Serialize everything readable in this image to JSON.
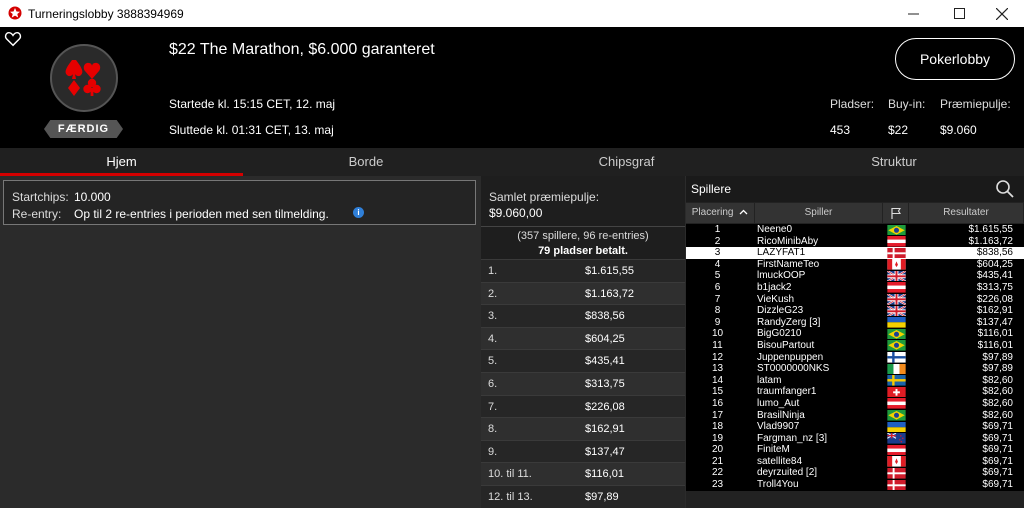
{
  "window": {
    "title": "Turneringslobby 3888394969"
  },
  "tournament": {
    "name": "$22 The Marathon, $6.000 garanteret",
    "status": "FÆRDIG",
    "started": "Startede kl. 15:15 CET, 12. maj",
    "ended": "Sluttede kl. 01:31 CET, 13. maj",
    "lobby_button": "Pokerlobby",
    "seats_label": "Pladser:",
    "seats_value": "453",
    "buyin_label": "Buy-in:",
    "buyin_value": "$22",
    "prizepool_label": "Præmiepulje:",
    "prizepool_value": "$9.060"
  },
  "tabs": [
    {
      "label": "Hjem",
      "active": true
    },
    {
      "label": "Borde",
      "active": false
    },
    {
      "label": "Chipsgraf",
      "active": false
    },
    {
      "label": "Struktur",
      "active": false
    }
  ],
  "info": {
    "startchips_label": "Startchips:",
    "startchips_value": "10.000",
    "reentry_label": "Re-entry:",
    "reentry_value": "Op til 2 re-entries i perioden med sen tilmelding."
  },
  "prizepool": {
    "label": "Samlet præmiepulje:",
    "value": "$9.060,00",
    "players_text": "(357 spillere, 96 re-entries)",
    "paid_text": "79 pladser betalt.",
    "payouts": [
      {
        "place": "1.",
        "amount": "$1.615,55"
      },
      {
        "place": "2.",
        "amount": "$1.163,72"
      },
      {
        "place": "3.",
        "amount": "$838,56"
      },
      {
        "place": "4.",
        "amount": "$604,25"
      },
      {
        "place": "5.",
        "amount": "$435,41"
      },
      {
        "place": "6.",
        "amount": "$313,75"
      },
      {
        "place": "7.",
        "amount": "$226,08"
      },
      {
        "place": "8.",
        "amount": "$162,91"
      },
      {
        "place": "9.",
        "amount": "$137,47"
      },
      {
        "place": "10. til 11.",
        "amount": "$116,01"
      },
      {
        "place": "12. til 13.",
        "amount": "$97,89"
      }
    ]
  },
  "players": {
    "title": "Spillere",
    "columns": {
      "place": "Placering",
      "player": "Spiller",
      "results": "Resultater"
    },
    "highlight_color": "#ffffff",
    "rows": [
      {
        "place": "1",
        "name": "Neene0",
        "flag": "br",
        "result": "$1.615,55"
      },
      {
        "place": "2",
        "name": "RicoMinibAby",
        "flag": "at",
        "result": "$1.163,72"
      },
      {
        "place": "3",
        "name": "LAZYFAT1",
        "flag": "dk",
        "result": "$838,56",
        "highlight": true
      },
      {
        "place": "4",
        "name": "FirstNameTeo",
        "flag": "ca",
        "result": "$604,25"
      },
      {
        "place": "5",
        "name": "lmuckOOP",
        "flag": "gb",
        "result": "$435,41"
      },
      {
        "place": "6",
        "name": "b1jack2",
        "flag": "at",
        "result": "$313,75"
      },
      {
        "place": "7",
        "name": "VieKush",
        "flag": "gb",
        "result": "$226,08"
      },
      {
        "place": "8",
        "name": "DizzleG23",
        "flag": "gb",
        "result": "$162,91"
      },
      {
        "place": "9",
        "name": "RandyZerg [3]",
        "flag": "ua",
        "result": "$137,47"
      },
      {
        "place": "10",
        "name": "BigG0210",
        "flag": "br",
        "result": "$116,01"
      },
      {
        "place": "11",
        "name": "BisouPartout",
        "flag": "br",
        "result": "$116,01"
      },
      {
        "place": "12",
        "name": "Juppenpuppen",
        "flag": "fi",
        "result": "$97,89"
      },
      {
        "place": "13",
        "name": "ST0000000NKS",
        "flag": "ie",
        "result": "$97,89"
      },
      {
        "place": "14",
        "name": "latam",
        "flag": "se",
        "result": "$82,60"
      },
      {
        "place": "15",
        "name": "traumfanger1",
        "flag": "ch",
        "result": "$82,60"
      },
      {
        "place": "16",
        "name": "lumo_Aut",
        "flag": "at",
        "result": "$82,60"
      },
      {
        "place": "17",
        "name": "BrasilNinja",
        "flag": "br",
        "result": "$82,60"
      },
      {
        "place": "18",
        "name": "Vlad9907",
        "flag": "ua",
        "result": "$69,71"
      },
      {
        "place": "19",
        "name": "Fargman_nz [3]",
        "flag": "nz",
        "result": "$69,71"
      },
      {
        "place": "20",
        "name": "FiniteM",
        "flag": "at",
        "result": "$69,71"
      },
      {
        "place": "21",
        "name": "satellite84",
        "flag": "ca",
        "result": "$69,71"
      },
      {
        "place": "22",
        "name": "deyrzuited [2]",
        "flag": "dk",
        "result": "$69,71"
      },
      {
        "place": "23",
        "name": "Troll4You",
        "flag": "dk",
        "result": "$69,71"
      }
    ]
  }
}
